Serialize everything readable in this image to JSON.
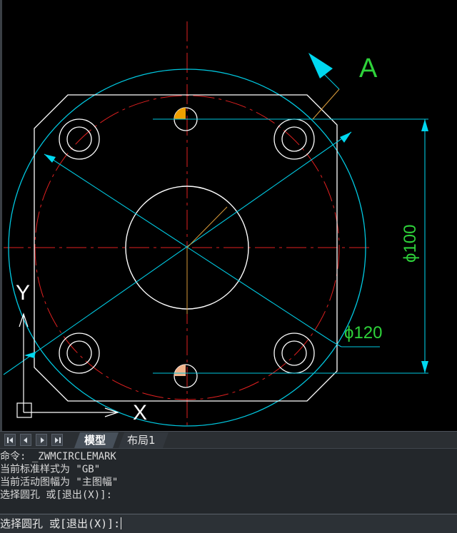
{
  "canvas": {
    "background": "#000000",
    "colors": {
      "geometry": "#ffffff",
      "dimension": "#00c8e0",
      "centerline": "#e02020",
      "text_green": "#2ed23a",
      "leader": "#d89a3a",
      "marker_orange": "#f0a000",
      "marker_peach": "#f2b28a",
      "arrow_cyan": "#00d8f0"
    },
    "labels": {
      "section_label": "A",
      "dim_diameter_100": "ϕ100",
      "dim_diameter_120": "ϕ120",
      "ucs_y": "Y",
      "ucs_x": "X"
    }
  },
  "tabs": {
    "model": "模型",
    "layout1": "布局1"
  },
  "command": {
    "history": [
      "命令: _ZWMCIRCLEMARK",
      "当前标准样式为 \"GB\"",
      "当前活动图幅为 \"主图幅\"",
      "选择圆孔 或[退出(X)]:"
    ],
    "prompt": "选择圆孔 或[退出(X)]:"
  }
}
